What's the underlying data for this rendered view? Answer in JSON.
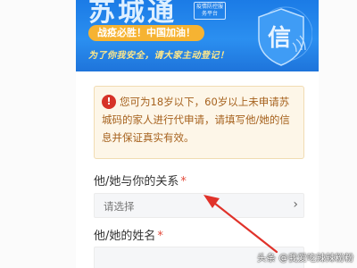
{
  "banner": {
    "title": "苏城通",
    "subtitle": "疫情防控服务平台",
    "slogan": "战疫必胜！中国加油！",
    "handwriting": "为了你我安全，请大家主动登记！",
    "shield_glyph": "信"
  },
  "notice": {
    "icon": "!",
    "text": "您可为18岁以下，60岁以上未申请苏城码的家人进行代申请，请填写他/她的信息并保证真实有效。"
  },
  "form": {
    "relation_label": "他/她与你的关系",
    "relation_placeholder": "请选择",
    "name_label": "他/她的姓名",
    "required_mark": "*",
    "chevron": "›"
  },
  "watermark": "头条 @我爱吃辣辣粉粉",
  "colors": {
    "banner_blue": "#1b7be6",
    "slogan_orange": "#f6b332",
    "notice_bg": "#fdf6e8",
    "notice_text": "#a6621e",
    "warn_red": "#d63228",
    "required_red": "#e24a3b",
    "arrow_red": "#e0322a"
  }
}
